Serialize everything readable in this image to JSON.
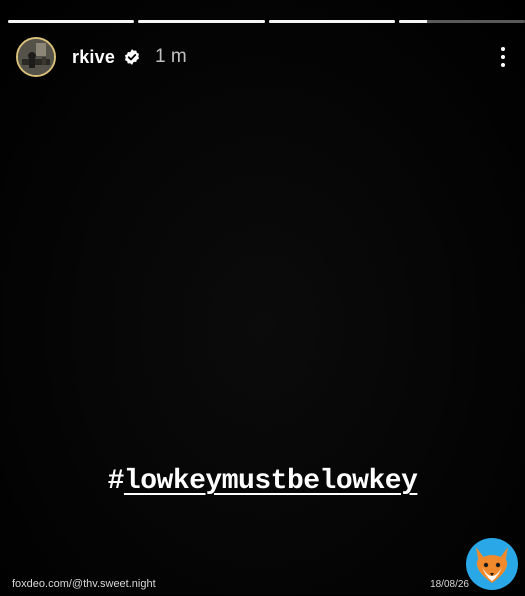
{
  "story": {
    "progress": [
      1,
      1,
      1,
      0.22
    ],
    "user": {
      "username": "rkive",
      "verified": true,
      "posted_ago": "1 m"
    },
    "icons": {
      "avatar": "profile-photo",
      "verified": "verified-badge-icon",
      "more": "more-options-icon"
    },
    "hashtag": {
      "symbol": "#",
      "text": "lowkeymustbelowkey"
    }
  },
  "watermark": {
    "source": "foxdeo.com/@thv.sweet.night",
    "date": "18/08/26",
    "logo": "fox-logo-icon"
  }
}
